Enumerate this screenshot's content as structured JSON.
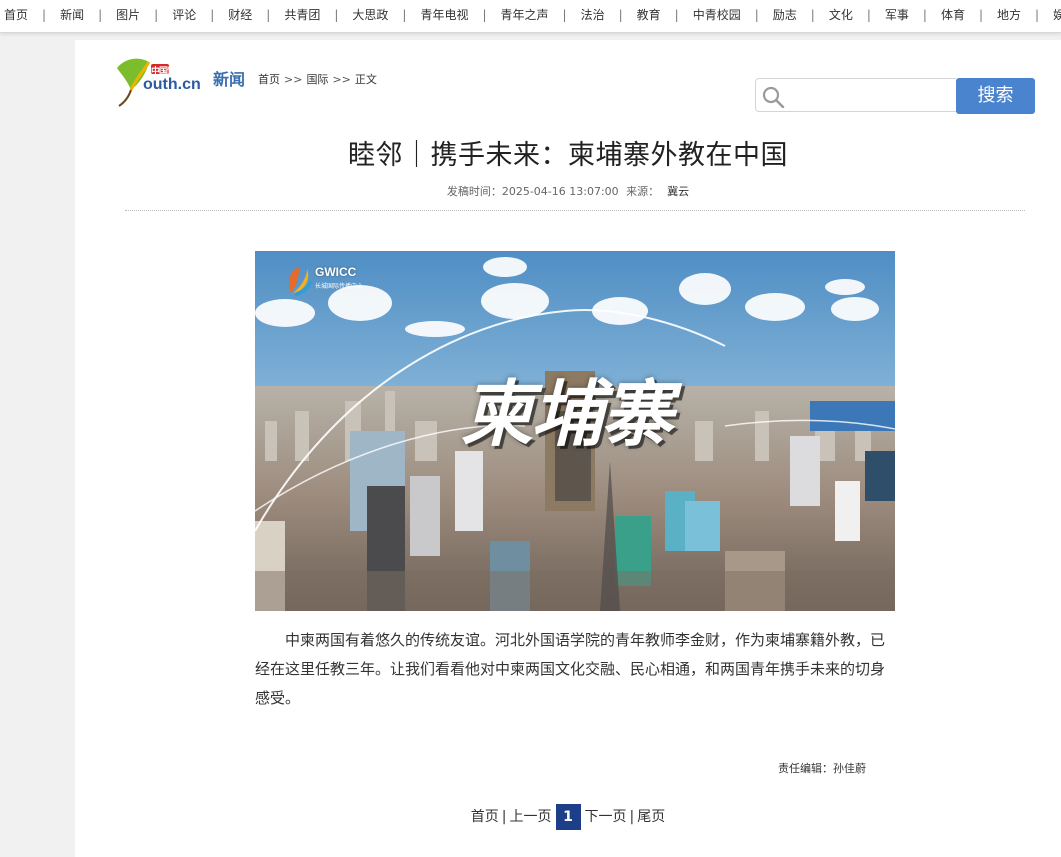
{
  "nav": {
    "items": [
      "首页",
      "新闻",
      "图片",
      "评论",
      "财经",
      "共青团",
      "大思政",
      "青年电视",
      "青年之声",
      "法治",
      "教育",
      "中青校园",
      "励志",
      "文化",
      "军事",
      "体育",
      "地方",
      "娱乐"
    ]
  },
  "header": {
    "logo_text": "outh.cn",
    "logo_tag": "中国青年网",
    "section_name": "新闻",
    "breadcrumb": [
      "首页",
      ">>",
      "国际",
      ">>",
      "正文"
    ]
  },
  "search": {
    "placeholder": "",
    "button_label": "搜索"
  },
  "article": {
    "title": "睦邻｜携手未来：柬埔寨外教在中国",
    "publish_label": "发稿时间：",
    "publish_time": "2025-04-16 13:07:00",
    "source_label": "来源：",
    "source": "冀云",
    "hero_text": "柬埔寨",
    "hero_brand": "GWICC",
    "hero_brand_sub": "长城国际传播中心",
    "body": "中柬两国有着悠久的传统友谊。河北外国语学院的青年教师李金财，作为柬埔寨籍外教，已经在这里任教三年。让我们看看他对中柬两国文化交融、民心相通，和两国青年携手未来的切身感受。",
    "editor": "责任编辑：孙佳蔚"
  },
  "pagination": {
    "first": "首页",
    "prev": "上一页",
    "current": "1",
    "next": "下一页",
    "last": "尾页"
  },
  "colors": {
    "search_button": "#4a84cf",
    "page_current": "#1d3f8a",
    "section_blue": "#3a6fb0"
  }
}
